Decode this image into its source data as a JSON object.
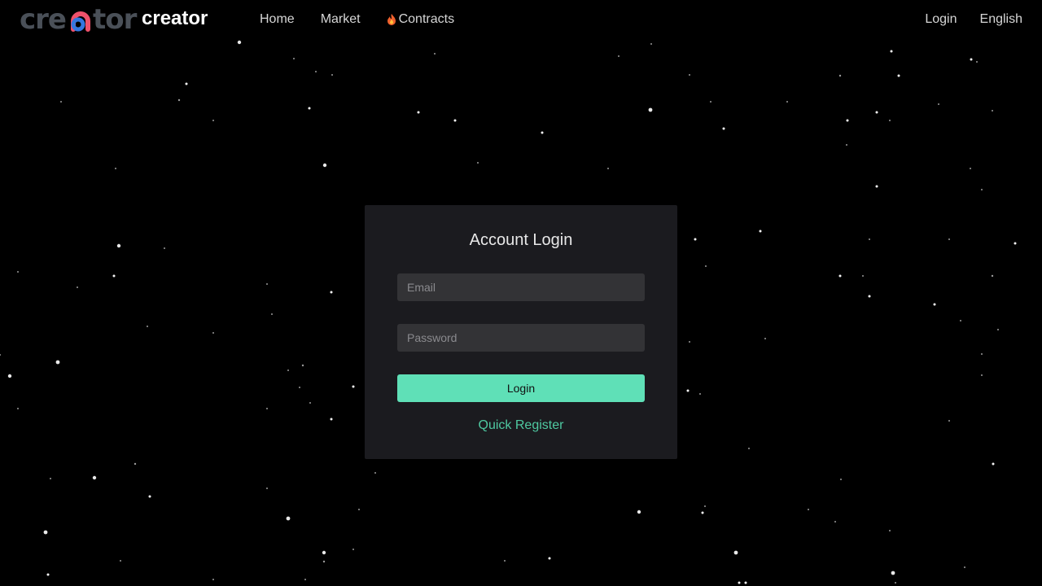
{
  "brand": {
    "name": "creator",
    "wordmark": "creator"
  },
  "nav": {
    "items": [
      {
        "label": "Home"
      },
      {
        "label": "Market"
      },
      {
        "label": "Contracts",
        "icon": "fire-icon"
      }
    ],
    "login_label": "Login",
    "language_label": "English"
  },
  "login": {
    "title": "Account Login",
    "email_placeholder": "Email",
    "password_placeholder": "Password",
    "submit_label": "Login",
    "register_label": "Quick Register"
  },
  "colors": {
    "background": "#000000",
    "card": "#1b1b1f",
    "input": "#333336",
    "accent": "#5fe0b7",
    "link": "#4fc9a1",
    "logo_gray": "#4a5058",
    "logo_pink": "#f0516b",
    "logo_blue": "#3577e0"
  }
}
